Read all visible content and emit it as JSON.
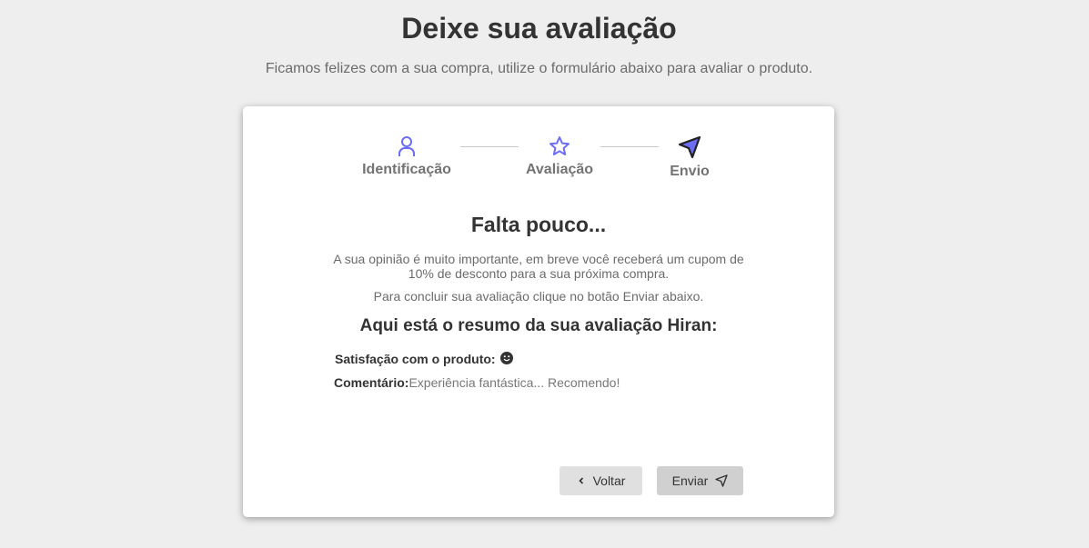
{
  "header": {
    "title": "Deixe sua avaliação",
    "subtitle": "Ficamos felizes com a sua compra, utilize o formulário abaixo para avaliar o produto."
  },
  "steps": [
    {
      "label": "Identificação",
      "icon": "user-icon"
    },
    {
      "label": "Avaliação",
      "icon": "star-icon"
    },
    {
      "label": "Envio",
      "icon": "send-icon"
    }
  ],
  "content": {
    "heading": "Falta pouco...",
    "paragraph1": "A sua opinião é muito importante, em breve você receberá um cupom de 10% de desconto para a sua próxima compra.",
    "paragraph2": "Para concluir sua avaliação clique no botão Enviar abaixo.",
    "summary_title": "Aqui está o resumo da sua avaliação Hiran:",
    "satisfaction_label": "Satisfação com o produto:",
    "satisfaction_icon": "smile-icon",
    "comment_label": "Comentário:",
    "comment_value": "Experiência fantástica... Recomendo!"
  },
  "buttons": {
    "back": "Voltar",
    "send": "Enviar"
  },
  "colors": {
    "accent": "#6c6cf5",
    "background": "#eeeeee"
  }
}
